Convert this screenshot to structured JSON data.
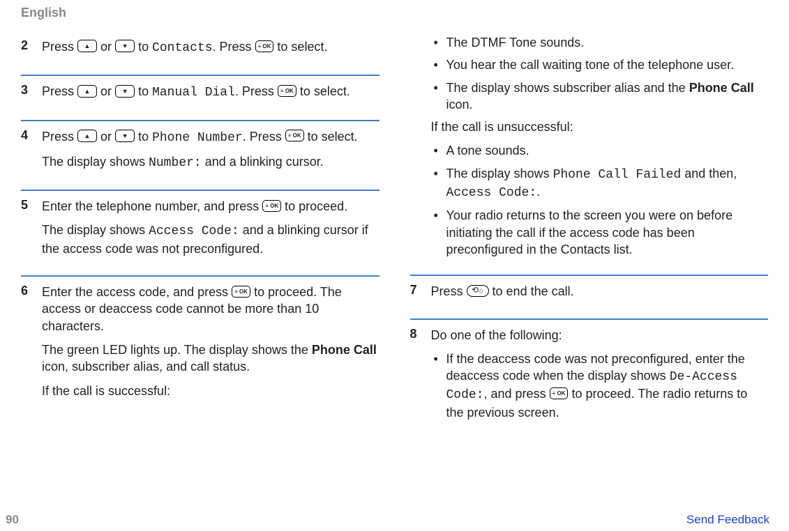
{
  "header": {
    "language": "English"
  },
  "left": {
    "step2": {
      "num": "2",
      "t1": "Press ",
      "t2": " or ",
      "t3": " to ",
      "code": "Contacts",
      "t4": ". Press ",
      "t5": " to select."
    },
    "step3": {
      "num": "3",
      "t1": "Press ",
      "t2": " or ",
      "t3": " to ",
      "code": "Manual Dial",
      "t4": ". Press ",
      "t5": " to select."
    },
    "step4": {
      "num": "4",
      "t1": "Press ",
      "t2": " or ",
      "t3": " to ",
      "code": "Phone Number",
      "t4": ". Press ",
      "t5": " to select.",
      "p2a": "The display shows ",
      "p2code": "Number:",
      "p2b": " and a blinking cursor."
    },
    "step5": {
      "num": "5",
      "p1a": "Enter the telephone number, and press ",
      "p1b": " to proceed.",
      "p2a": "The display shows ",
      "p2code": "Access Code:",
      "p2b": " and a blinking cursor if the access code was not preconfigured."
    },
    "step6": {
      "num": "6",
      "p1a": "Enter the access code, and press ",
      "p1b": " to proceed. The access or deaccess code cannot be more than 10 characters.",
      "p2a": "The green LED lights up. The display shows the ",
      "p2bold": "Phone Call",
      "p2b": " icon, subscriber alias, and call status.",
      "p3": "If the call is successful:"
    }
  },
  "right": {
    "bullets1": {
      "b1": "The DTMF Tone sounds.",
      "b2": "You hear the call waiting tone of the telephone user.",
      "b3a": "The display shows subscriber alias and the ",
      "b3bold": "Phone Call",
      "b3b": " icon."
    },
    "unsucc": "If the call is unsuccessful:",
    "bullets2": {
      "b1": "A tone sounds.",
      "b2a": "The display shows ",
      "b2code1": "Phone Call Failed",
      "b2mid": " and then, ",
      "b2code2": "Access Code:",
      "b2end": ".",
      "b3": "Your radio returns to the screen you were on before initiating the call if the access code has been preconfigured in the Contacts list."
    },
    "step7": {
      "num": "7",
      "t1": "Press ",
      "t2": " to end the call."
    },
    "step8": {
      "num": "8",
      "p1": "Do one of the following:",
      "b1a": "If the deaccess code was not preconfigured, enter the deaccess code when the display shows ",
      "b1code": "De-Access Code:",
      "b1b": ", and press ",
      "b1c": " to proceed. The radio returns to the previous screen."
    }
  },
  "footer": {
    "page": "90",
    "link": "Send Feedback"
  }
}
